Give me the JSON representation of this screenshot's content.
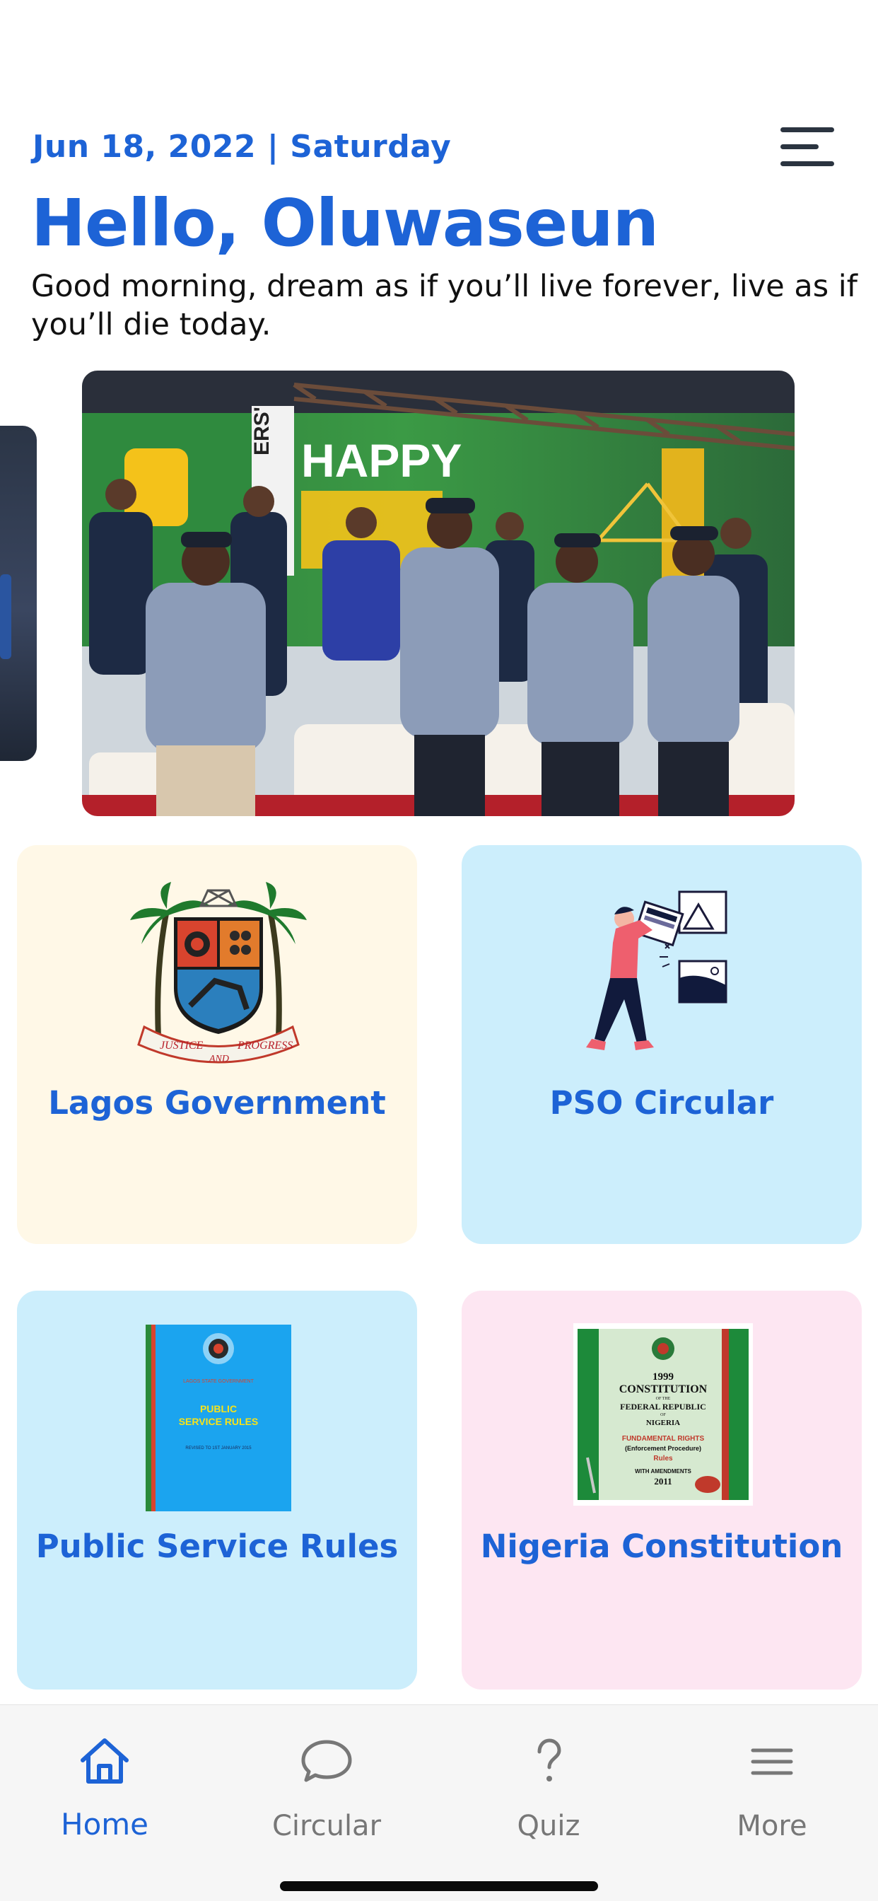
{
  "header": {
    "date": "Jun 18, 2022",
    "separator": "|",
    "weekday": "Saturday",
    "greeting": "Hello, Oluwaseun",
    "quote": "Good morning, dream as if you’ll live forever, live as if you’ll die today."
  },
  "menu": {
    "icon": "hamburger-menu-icon"
  },
  "banner": {
    "sign_text": "HAPPY",
    "icon": "event-photo"
  },
  "cards": [
    {
      "label": "Lagos Government",
      "icon": "lagos-coat-of-arms"
    },
    {
      "label": "PSO Circular",
      "icon": "person-carrying-frames-illustration"
    },
    {
      "label": "Public Service Rules",
      "icon": "public-service-rules-book-cover",
      "cover": {
        "line1": "LAGOS STATE GOVERNMENT",
        "line2": "PUBLIC",
        "line3": "SERVICE RULES",
        "line4": "REVISED TO 1ST JANUARY 2015"
      }
    },
    {
      "label": "Nigeria Constitution",
      "icon": "constitution-book-cover",
      "cover": {
        "line1": "1999",
        "line2": "CONSTITUTION",
        "line3": "OF THE",
        "line4": "FEDERAL REPUBLIC",
        "line5": "OF",
        "line6": "NIGERIA",
        "line7": "FUNDAMENTAL RIGHTS",
        "line8": "(Enforcement Procedure)",
        "line9": "Rules",
        "line10": "WITH AMENDMENTS",
        "line11": "2011"
      }
    }
  ],
  "coat_of_arms_motto": [
    "JUSTICE",
    "AND",
    "PROGRESS"
  ],
  "bottom_nav": [
    {
      "label": "Home",
      "icon": "home-icon",
      "active": true
    },
    {
      "label": "Circular",
      "icon": "chat-bubble-icon",
      "active": false
    },
    {
      "label": "Quiz",
      "icon": "question-mark-icon",
      "active": false
    },
    {
      "label": "More",
      "icon": "menu-lines-icon",
      "active": false
    }
  ],
  "colors": {
    "accent": "#1d63d6",
    "card_cream": "#fff8e7",
    "card_blue": "#cceefc",
    "card_pink": "#fde6f2"
  }
}
